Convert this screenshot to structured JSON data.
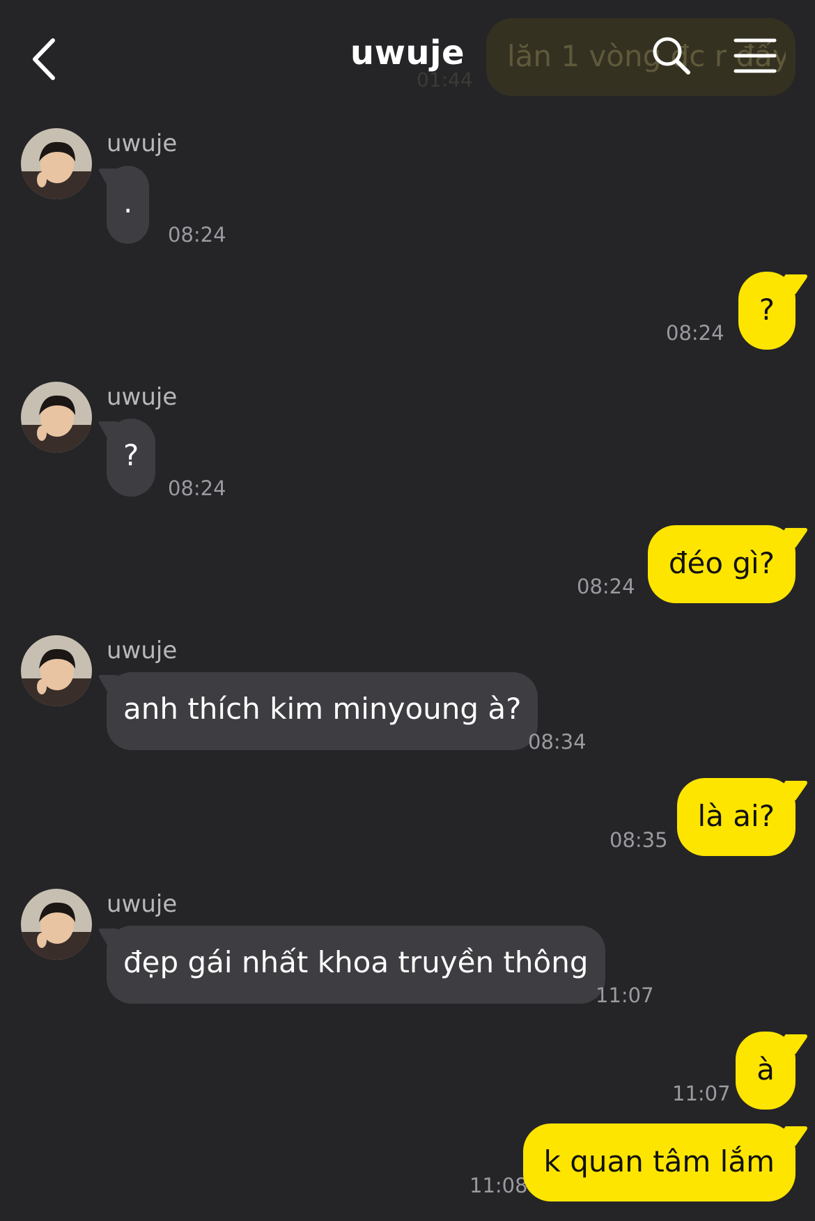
{
  "header": {
    "title": "uwuje",
    "back_icon": "chevron-left-icon",
    "search_icon": "search-icon",
    "menu_icon": "menu-icon",
    "pinned_preview_text": "lăn 1 vòng đc r đấy",
    "pinned_preview_time": "01:44"
  },
  "colors": {
    "background": "#252528",
    "incoming_bubble": "#3d3d42",
    "outgoing_bubble": "#fee500",
    "timestamp": "#9a9aa0"
  },
  "messages": [
    {
      "from": "them",
      "sender": "uwuje",
      "text": ".",
      "time": "08:24"
    },
    {
      "from": "me",
      "text": "?",
      "time": "08:24"
    },
    {
      "from": "them",
      "sender": "uwuje",
      "text": "?",
      "time": "08:24"
    },
    {
      "from": "me",
      "text": "đéo gì?",
      "time": "08:24"
    },
    {
      "from": "them",
      "sender": "uwuje",
      "text": "anh thích kim minyoung à?",
      "time": "08:34"
    },
    {
      "from": "me",
      "text": "là ai?",
      "time": "08:35"
    },
    {
      "from": "them",
      "sender": "uwuje",
      "text": "đẹp gái nhất khoa truyền thông",
      "time": "11:07"
    },
    {
      "from": "me",
      "text": "à",
      "time": "11:07"
    },
    {
      "from": "me",
      "text": "k quan tâm lắm",
      "time": "11:08"
    }
  ]
}
